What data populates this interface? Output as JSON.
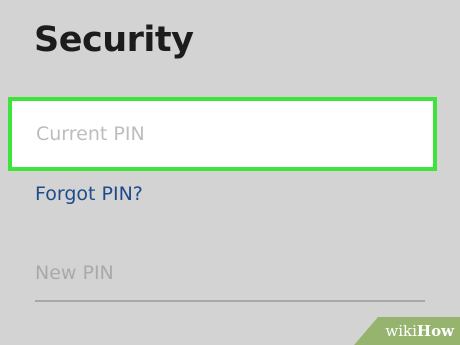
{
  "page": {
    "title": "Security"
  },
  "form": {
    "current_pin": {
      "placeholder": "Current PIN",
      "value": ""
    },
    "forgot_pin_label": "Forgot PIN?",
    "new_pin": {
      "placeholder": "New PIN",
      "value": ""
    }
  },
  "highlight": {
    "color": "#3ee43c"
  },
  "watermark": {
    "prefix": "wiki",
    "suffix": "How"
  }
}
